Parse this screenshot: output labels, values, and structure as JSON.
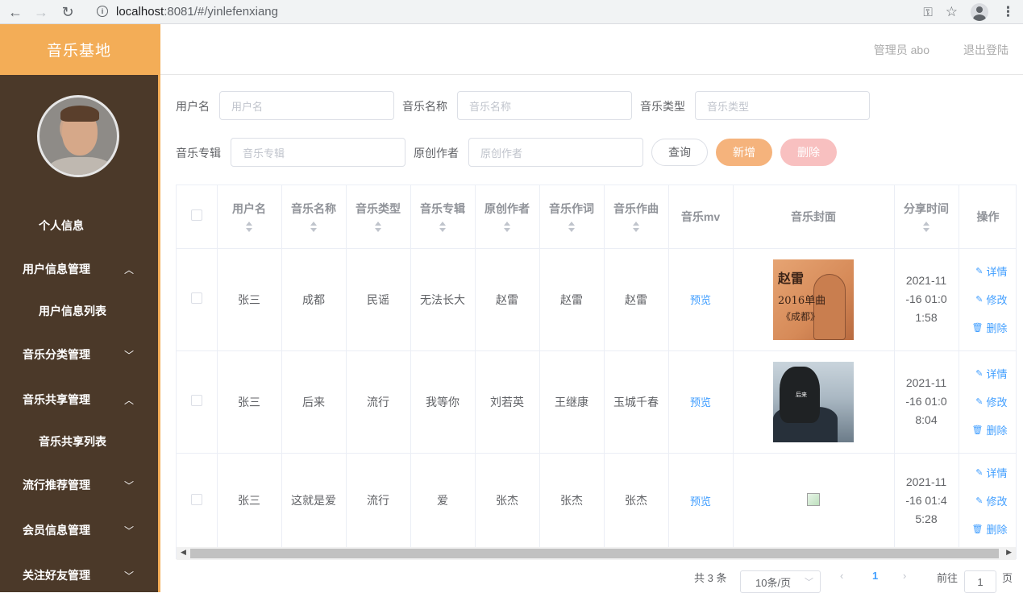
{
  "browser": {
    "url_host": "localhost",
    "url_rest": ":8081/#/yinlefenxiang"
  },
  "sidebar": {
    "brand": "音乐基地",
    "items": [
      {
        "label": "个人信息",
        "expanded": null,
        "sub": false
      },
      {
        "label": "用户信息管理",
        "expanded": true,
        "sub": false
      },
      {
        "label": "用户信息列表",
        "expanded": null,
        "sub": true
      },
      {
        "label": "音乐分类管理",
        "expanded": false,
        "sub": false
      },
      {
        "label": "音乐共享管理",
        "expanded": true,
        "sub": false
      },
      {
        "label": "音乐共享列表",
        "expanded": null,
        "sub": true
      },
      {
        "label": "流行推荐管理",
        "expanded": false,
        "sub": false
      },
      {
        "label": "会员信息管理",
        "expanded": false,
        "sub": false
      },
      {
        "label": "关注好友管理",
        "expanded": false,
        "sub": false
      }
    ]
  },
  "header": {
    "admin": "管理员 abo",
    "logout": "退出登陆"
  },
  "search": {
    "username_label": "用户名",
    "username_placeholder": "用户名",
    "music_name_label": "音乐名称",
    "music_name_placeholder": "音乐名称",
    "music_type_label": "音乐类型",
    "music_type_placeholder": "音乐类型",
    "album_label": "音乐专辑",
    "album_placeholder": "音乐专辑",
    "author_label": "原创作者",
    "author_placeholder": "原创作者",
    "query_button": "查询",
    "add_button": "新增",
    "delete_button": "删除"
  },
  "table": {
    "headers": [
      "用户名",
      "音乐名称",
      "音乐类型",
      "音乐专辑",
      "原创作者",
      "音乐作词",
      "音乐作曲",
      "音乐mv",
      "音乐封面",
      "分享时间",
      "操作"
    ],
    "rows": [
      {
        "username": "张三",
        "name": "成都",
        "type": "民谣",
        "album": "无法长大",
        "author": "赵雷",
        "lyricist": "赵雷",
        "composer": "赵雷",
        "mv": "预览",
        "time_lines": [
          "2021-11",
          "-16 01:0",
          "1:58"
        ]
      },
      {
        "username": "张三",
        "name": "后来",
        "type": "流行",
        "album": "我等你",
        "author": "刘若英",
        "lyricist": "王继康",
        "composer": "玉城千春",
        "mv": "预览",
        "time_lines": [
          "2021-11",
          "-16 01:0",
          "8:04"
        ]
      },
      {
        "username": "张三",
        "name": "这就是爱",
        "type": "流行",
        "album": "爱",
        "author": "张杰",
        "lyricist": "张杰",
        "composer": "张杰",
        "mv": "预览",
        "time_lines": [
          "2021-11",
          "-16 01:4",
          "5:28"
        ]
      }
    ],
    "ops": {
      "detail": "详情",
      "edit": "修改",
      "delete": "删除"
    },
    "cover1_text": [
      "赵雷",
      "2016单曲",
      "《成都》"
    ],
    "cover2_text": "后来"
  },
  "pagination": {
    "total": "共 3 条",
    "page_size": "10条/页",
    "current_page": "1",
    "goto_label": "前往",
    "goto_value": "1",
    "page_suffix": "页"
  }
}
